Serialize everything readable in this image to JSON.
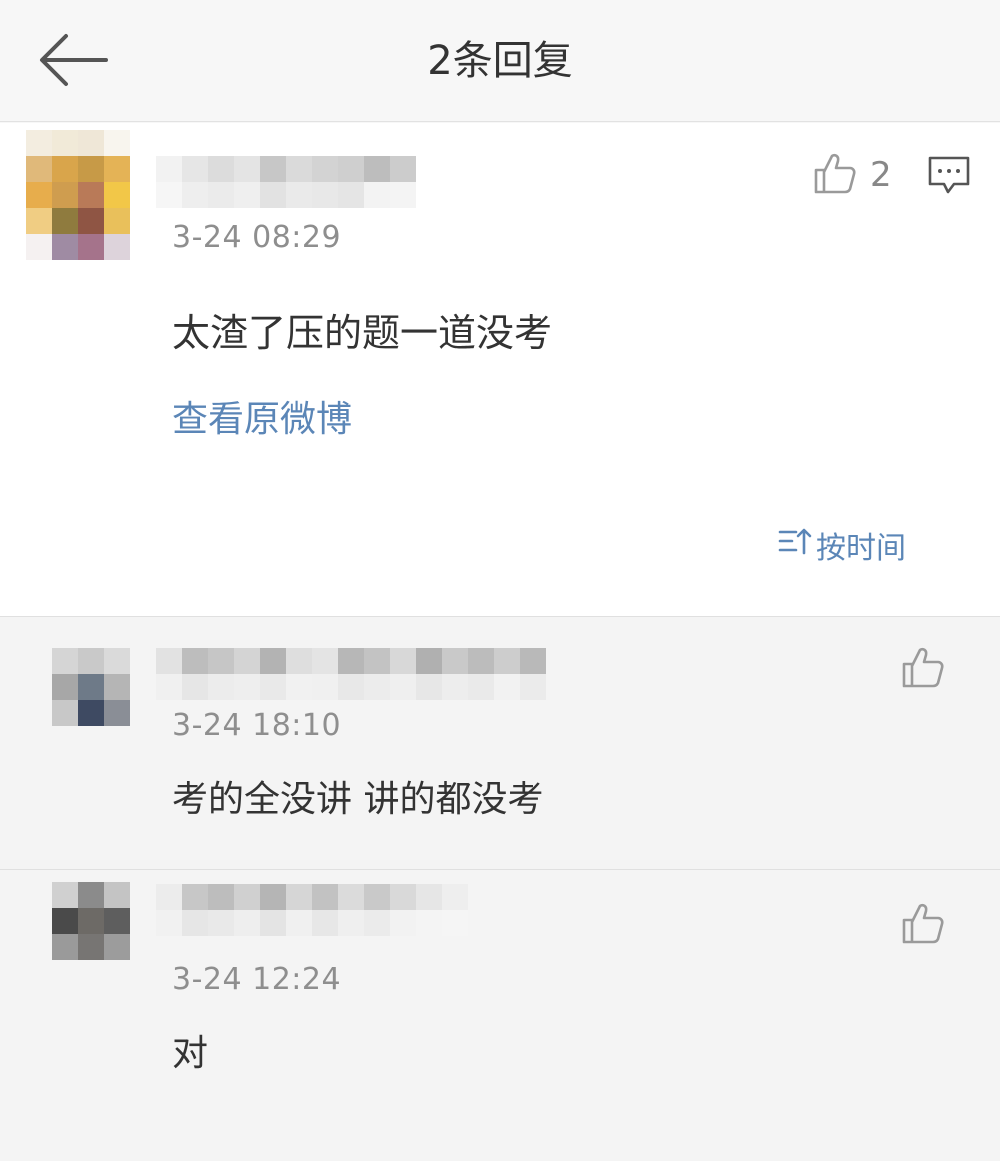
{
  "navbar": {
    "title": "2条回复",
    "back_icon": "arrow-left-icon"
  },
  "main_comment": {
    "timestamp": "3-24 08:29",
    "text": "太渣了压的题一道没考",
    "like_count": "2",
    "view_original_label": "查看原微博",
    "like_icon": "thumbs-up-icon",
    "reply_icon": "comment-bubble-icon"
  },
  "sort": {
    "label": "按时间",
    "icon": "sort-icon"
  },
  "replies": [
    {
      "timestamp": "3-24 18:10",
      "text": "考的全没讲 讲的都没考",
      "like_icon": "thumbs-up-icon"
    },
    {
      "timestamp": "3-24 12:24",
      "text": "对",
      "like_icon": "thumbs-up-icon"
    }
  ],
  "colors": {
    "accent_link": "#5b86b7",
    "text_primary": "#333333",
    "text_secondary": "#8e8e8e",
    "background": "#f7f7f7"
  }
}
